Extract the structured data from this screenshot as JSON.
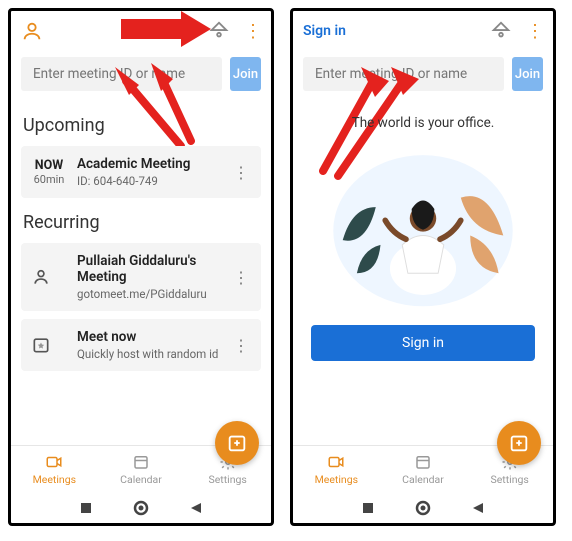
{
  "left": {
    "search": {
      "placeholder": "Enter meeting ID or name",
      "join_label": "Join"
    },
    "sections": {
      "upcoming_title": "Upcoming",
      "recurring_title": "Recurring"
    },
    "upcoming": {
      "now_label": "NOW",
      "duration": "60min",
      "title": "Academic Meeting",
      "sub": "ID: 604-640-749"
    },
    "recurring": [
      {
        "title": "Pullaiah Giddaluru's Meeting",
        "sub": "gotomeet.me/PGiddaluru"
      },
      {
        "title": "Meet now",
        "sub": "Quickly host with random id"
      }
    ],
    "nav": {
      "meetings": "Meetings",
      "calendar": "Calendar",
      "settings": "Settings"
    }
  },
  "right": {
    "signin_link": "Sign in",
    "search": {
      "placeholder": "Enter meeting ID or name",
      "join_label": "Join"
    },
    "hero_text": "The world is your office.",
    "signin_button": "Sign in",
    "nav": {
      "meetings": "Meetings",
      "calendar": "Calendar",
      "settings": "Settings"
    }
  }
}
